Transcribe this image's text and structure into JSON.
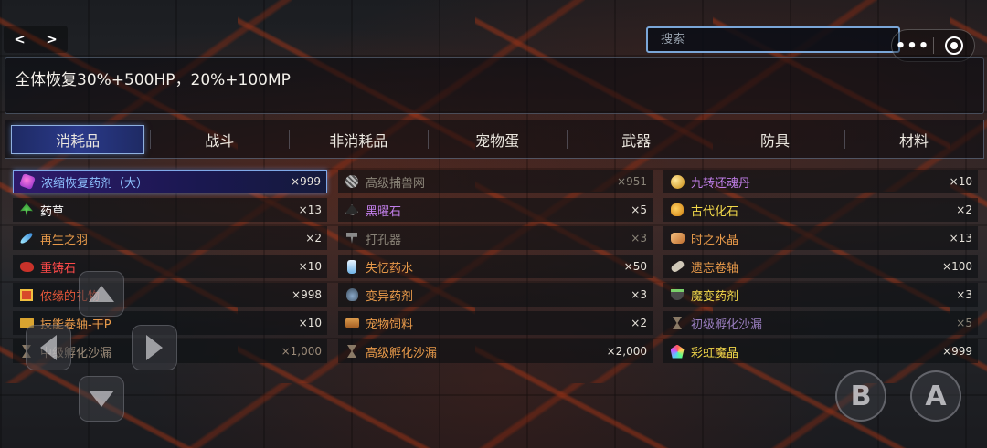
{
  "nav": {
    "back": "<",
    "forward": ">"
  },
  "search": {
    "placeholder": "搜索"
  },
  "capsule": {
    "more": "•••"
  },
  "description": "全体恢复30%+500HP，20%+100MP",
  "tabs": [
    {
      "label": "消耗品",
      "active": true
    },
    {
      "label": "战斗"
    },
    {
      "label": "非消耗品"
    },
    {
      "label": "宠物蛋"
    },
    {
      "label": "武器"
    },
    {
      "label": "防具"
    },
    {
      "label": "材料"
    }
  ],
  "items": [
    {
      "name": "浓缩恢复药剂（大）",
      "count": "×999",
      "color": "#8ec2ff",
      "icon": "potion-icon"
    },
    {
      "name": "高级捕兽网",
      "count": "×951",
      "color": "#8a8478",
      "icon": "net-icon"
    },
    {
      "name": "九转还魂丹",
      "count": "×10",
      "color": "#c07ee8",
      "icon": "pill-icon"
    },
    {
      "name": "药草",
      "count": "×13",
      "color": "#ffffff",
      "icon": "herb-icon"
    },
    {
      "name": "黑曜石",
      "count": "×5",
      "color": "#c07ee8",
      "icon": "obsidian-icon"
    },
    {
      "name": "古代化石",
      "count": "×2",
      "color": "#f2d84a",
      "icon": "fossil-icon"
    },
    {
      "name": "再生之羽",
      "count": "×2",
      "color": "#e89a4a",
      "icon": "feather-icon"
    },
    {
      "name": "打孔器",
      "count": "×3",
      "color": "#8a8478",
      "icon": "drill-icon"
    },
    {
      "name": "时之水晶",
      "count": "×13",
      "color": "#e89a4a",
      "icon": "crystal-icon"
    },
    {
      "name": "重铸石",
      "count": "×10",
      "color": "#ff4a4a",
      "icon": "ore-icon"
    },
    {
      "name": "失忆药水",
      "count": "×50",
      "color": "#e89a4a",
      "icon": "bottle-icon"
    },
    {
      "name": "遗忘卷轴",
      "count": "×100",
      "color": "#e89a4a",
      "icon": "scroll-icon"
    },
    {
      "name": "侬缘的礼物",
      "count": "×998",
      "color": "#e8583a",
      "icon": "gift-icon"
    },
    {
      "name": "变异药剂",
      "count": "×3",
      "color": "#e89a4a",
      "icon": "flask-icon"
    },
    {
      "name": "魔变药剂",
      "count": "×3",
      "color": "#f2d84a",
      "icon": "cauldron-icon"
    },
    {
      "name": "技能卷轴-干P",
      "count": "×10",
      "color": "#e89a4a",
      "icon": "skill-scroll-icon"
    },
    {
      "name": "宠物饲料",
      "count": "×2",
      "color": "#e89a4a",
      "icon": "feed-icon"
    },
    {
      "name": "初级孵化沙漏",
      "count": "×5",
      "color": "#9a7ec0",
      "icon": "hourglass-icon"
    },
    {
      "name": "中级孵化沙漏",
      "count": "×1,000",
      "color": "#9a8a78",
      "icon": "hourglass-icon"
    },
    {
      "name": "高级孵化沙漏",
      "count": "×2,000",
      "color": "#e89a4a",
      "icon": "hourglass-icon"
    },
    {
      "name": "彩虹魔晶",
      "count": "×999",
      "color": "#f2d84a",
      "icon": "rainbow-crystal-icon"
    }
  ],
  "controls": {
    "b_label": "B",
    "a_label": "A"
  }
}
